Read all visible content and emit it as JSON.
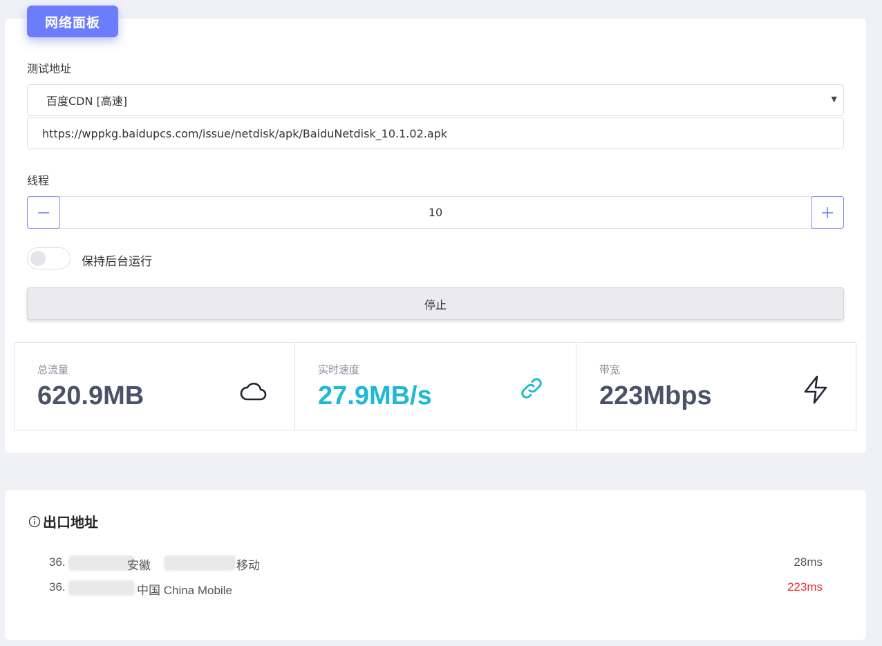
{
  "panel_tab": "网络面板",
  "address": {
    "label": "测试地址",
    "selected": "百度CDN [高速]",
    "url": "https://wppkg.baidupcs.com/issue/netdisk/apk/BaiduNetdisk_10.1.02.apk"
  },
  "threads": {
    "label": "线程",
    "value": "10"
  },
  "background": {
    "label": "保持后台运行",
    "enabled": false
  },
  "stop_button": "停止",
  "stats": [
    {
      "title": "总流量",
      "value": "620.9MB",
      "icon": "cloud-icon",
      "color": "#4a5268"
    },
    {
      "title": "实时速度",
      "value": "27.9MB/s",
      "icon": "link-icon",
      "color": "#1fb8d6"
    },
    {
      "title": "带宽",
      "value": "223Mbps",
      "icon": "lightning-icon",
      "color": "#4a5268"
    }
  ],
  "exit": {
    "title": "出口地址",
    "rows": [
      {
        "ip": "36.",
        "location": "安徽",
        "isp": "移动",
        "latency": "28ms",
        "latency_color": "#555555"
      },
      {
        "ip": "36.",
        "location": "中国 China Mobile",
        "isp": "",
        "latency": "223ms",
        "latency_color": "#f0302a"
      }
    ]
  },
  "colors": {
    "accent": "#6c7dfb",
    "speed": "#1fb8d6",
    "warning": "#f0302a"
  }
}
